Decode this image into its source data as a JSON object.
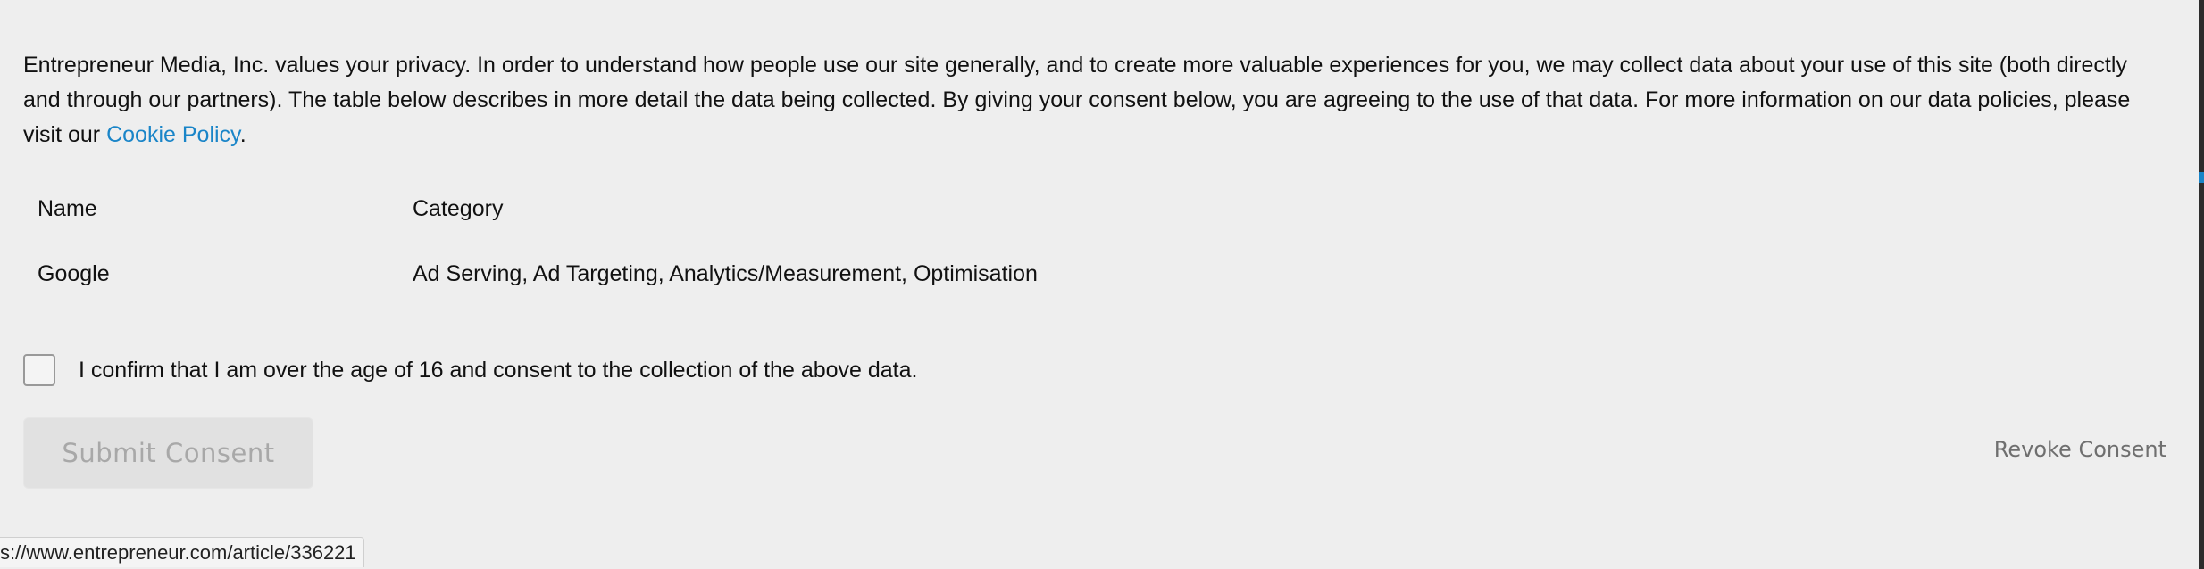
{
  "notice": {
    "text_before_link": "Entrepreneur Media, Inc. values your privacy. In order to understand how people use our site generally, and to create more valuable experiences for you, we may collect data about your use of this site (both directly and through our partners). The table below describes in more detail the data being collected. By giving your consent below, you are agreeing to the use of that data. For more information on our data policies, please visit our ",
    "link_text": "Cookie Policy",
    "text_after_link": "."
  },
  "table": {
    "headers": {
      "name": "Name",
      "category": "Category"
    },
    "rows": [
      {
        "name": "Google",
        "category": "Ad Serving, Ad Targeting, Analytics/Measurement, Optimisation"
      }
    ]
  },
  "consent": {
    "checked": false,
    "label": "I confirm that I am over the age of 16 and consent to the collection of the above data."
  },
  "buttons": {
    "submit_label": "Submit Consent",
    "revoke_label": "Revoke Consent"
  },
  "status_bar": {
    "url": "s://www.entrepreneur.com/article/336221"
  },
  "colors": {
    "link": "#1a85c8",
    "background": "#eeeeee",
    "disabled_button": "#e1e1e1"
  }
}
